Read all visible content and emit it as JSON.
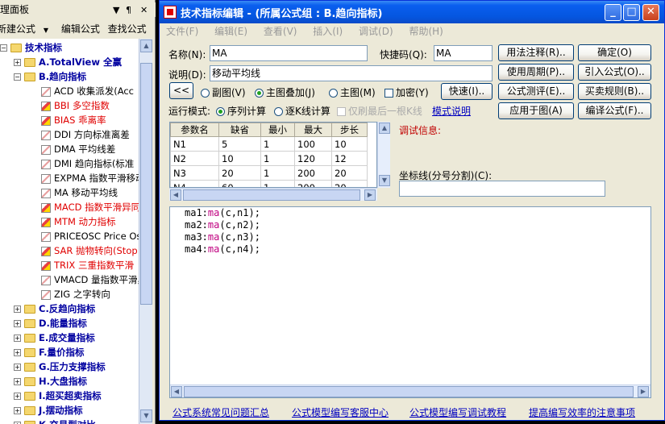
{
  "manager": {
    "title": "管理面板",
    "toolbar": {
      "new_formula": "新建公式",
      "edit_formula": "编辑公式",
      "find_formula": "查找公式"
    },
    "tree": [
      {
        "label": "技术指标",
        "level": 0,
        "kind": "root"
      },
      {
        "label": "A.TotalView 全赢",
        "level": 1,
        "kind": "folder"
      },
      {
        "label": "B.趋向指标",
        "level": 1,
        "kind": "folder"
      },
      {
        "label": "ACD 收集派发(Acc",
        "level": 2,
        "kind": "item"
      },
      {
        "label": "BBI 多空指数",
        "level": 2,
        "kind": "item-red"
      },
      {
        "label": "BIAS 乖离率",
        "level": 2,
        "kind": "item-red"
      },
      {
        "label": "DDI 方向标准离差",
        "level": 2,
        "kind": "item"
      },
      {
        "label": "DMA 平均线差",
        "level": 2,
        "kind": "item"
      },
      {
        "label": "DMI 趋向指标(标准",
        "level": 2,
        "kind": "item"
      },
      {
        "label": "EXPMA 指数平滑移动",
        "level": 2,
        "kind": "item"
      },
      {
        "label": "MA 移动平均线",
        "level": 2,
        "kind": "item"
      },
      {
        "label": "MACD 指数平滑异同",
        "level": 2,
        "kind": "item-red"
      },
      {
        "label": "MTM 动力指标",
        "level": 2,
        "kind": "item-red"
      },
      {
        "label": "PRICEOSC Price Os",
        "level": 2,
        "kind": "item"
      },
      {
        "label": "SAR 抛物转向(Stop",
        "level": 2,
        "kind": "item-red"
      },
      {
        "label": "TRIX 三重指数平滑",
        "level": 2,
        "kind": "item-red"
      },
      {
        "label": "VMACD 量指数平滑异",
        "level": 2,
        "kind": "item"
      },
      {
        "label": "ZIG 之字转向",
        "level": 2,
        "kind": "item"
      },
      {
        "label": "C.反趋向指标",
        "level": 1,
        "kind": "folder"
      },
      {
        "label": "D.能量指标",
        "level": 1,
        "kind": "folder"
      },
      {
        "label": "E.成交量指标",
        "level": 1,
        "kind": "folder"
      },
      {
        "label": "F.量价指标",
        "level": 1,
        "kind": "folder"
      },
      {
        "label": "G.压力支撑指标",
        "level": 1,
        "kind": "folder"
      },
      {
        "label": "H.大盘指标",
        "level": 1,
        "kind": "folder"
      },
      {
        "label": "I.超买超卖指标",
        "level": 1,
        "kind": "folder"
      },
      {
        "label": "J.摆动指标",
        "level": 1,
        "kind": "folder"
      },
      {
        "label": "K.交易型对比",
        "level": 1,
        "kind": "folder"
      }
    ]
  },
  "dialog": {
    "title": "技术指标编辑 - (所属公式组 : B.趋向指标)",
    "menu": [
      "文件(F)",
      "编辑(E)",
      "查看(V)",
      "插入(I)",
      "调试(D)",
      "帮助(H)"
    ],
    "name_label": "名称(N):",
    "name_value": "MA",
    "shortcut_label": "快捷码(Q):",
    "shortcut_value": "MA",
    "desc_label": "说明(D):",
    "desc_value": "移动平均线",
    "collapse_btn": "<<",
    "radio_sub": "副图(V)",
    "radio_main_overlay": "主图叠加(J)",
    "radio_main": "主图(M)",
    "check_encrypt": "加密(Y)",
    "quick_btn": "快速(I)..",
    "run_mode_label": "运行模式:",
    "run_seq": "序列计算",
    "run_each": "逐K线计算",
    "run_last": "仅刷最后一根K线",
    "mode_help": "模式说明",
    "btn_usage": "用法注释(R)..",
    "btn_ok": "确定(O)",
    "btn_period": "使用周期(P)..",
    "btn_import": "引入公式(O)..",
    "btn_eval": "公式测评(E)..",
    "btn_buysell": "买卖规则(B)..",
    "btn_apply": "应用于图(A)",
    "btn_compile": "编译公式(F)..",
    "debug_label": "调试信息:",
    "coord_label": "坐标线(分号分割)(C):",
    "params": {
      "headers": [
        "参数名",
        "缺省",
        "最小",
        "最大",
        "步长"
      ],
      "rows": [
        [
          "N1",
          "5",
          "1",
          "100",
          "10"
        ],
        [
          "N2",
          "10",
          "1",
          "120",
          "12"
        ],
        [
          "N3",
          "20",
          "1",
          "200",
          "20"
        ],
        [
          "N4",
          "60",
          "1",
          "200",
          "20"
        ]
      ]
    },
    "code": [
      {
        "pre": "ma1:",
        "fn": "ma",
        "args": "(c,n1);"
      },
      {
        "pre": "ma2:",
        "fn": "ma",
        "args": "(c,n2);"
      },
      {
        "pre": "ma3:",
        "fn": "ma",
        "args": "(c,n3);"
      },
      {
        "pre": "ma4:",
        "fn": "ma",
        "args": "(c,n4);"
      }
    ],
    "links": [
      "公式系统常见问题汇总",
      "公式模型编写客服中心",
      "公式模型编写调试教程",
      "提高编写效率的注意事项"
    ]
  }
}
